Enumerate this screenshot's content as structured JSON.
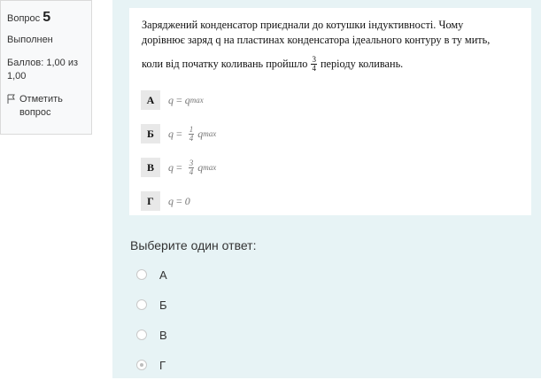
{
  "info": {
    "question_word": "Вопрос",
    "question_number": "5",
    "status": "Выполнен",
    "marks": "Баллов: 1,00 из 1,00",
    "flag_label": "Отметить вопрос"
  },
  "question": {
    "line1": "Заряджений конденсатор приєднали до котушки індуктивності. Чому",
    "line2": "дорівнює заряд q на пластинах конденсатора ідеального контуру в ту мить,",
    "line3_before": "коли від початку коливань пройшло",
    "line3_frac_num": "3",
    "line3_frac_den": "4",
    "line3_after": "періоду коливань.",
    "options": [
      {
        "letter": "А",
        "q": "q",
        "eq": "=",
        "rhs": "q",
        "sub": "max",
        "frac": null
      },
      {
        "letter": "Б",
        "q": "q",
        "eq": "=",
        "rhs": "q",
        "sub": "max",
        "frac": {
          "num": "1",
          "den": "4"
        }
      },
      {
        "letter": "В",
        "q": "q",
        "eq": "=",
        "rhs": "q",
        "sub": "max",
        "frac": {
          "num": "3",
          "den": "4"
        }
      },
      {
        "letter": "Г",
        "q": "q",
        "eq": "=",
        "rhs": "0",
        "sub": "",
        "frac": null
      }
    ]
  },
  "prompt": "Выберите один ответ:",
  "answers": [
    {
      "label": "А",
      "checked": false
    },
    {
      "label": "Б",
      "checked": false
    },
    {
      "label": "В",
      "checked": false
    },
    {
      "label": "Г",
      "checked": true
    }
  ]
}
